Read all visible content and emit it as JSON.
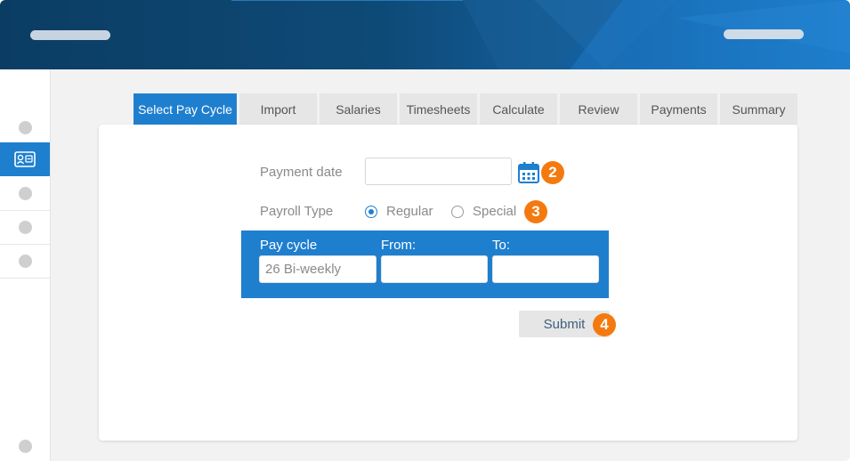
{
  "tabs": [
    {
      "label": "Select Pay Cycle"
    },
    {
      "label": "Import"
    },
    {
      "label": "Salaries"
    },
    {
      "label": "Timesheets"
    },
    {
      "label": "Calculate"
    },
    {
      "label": "Review"
    },
    {
      "label": "Payments"
    },
    {
      "label": "Summary"
    }
  ],
  "form": {
    "payment_date_label": "Payment date",
    "payment_date_value": "",
    "payroll_type_label": "Payroll Type",
    "payroll_options": [
      {
        "label": "Regular",
        "checked": true
      },
      {
        "label": "Special",
        "checked": false
      }
    ],
    "pay_cycle_label": "Pay cycle",
    "pay_cycle_value": "26 Bi-weekly",
    "from_label": "From:",
    "from_value": "",
    "to_label": "To:",
    "to_value": "",
    "submit_label": "Submit"
  },
  "badges": [
    "2",
    "3",
    "4"
  ],
  "colors": {
    "accent": "#1f7fcf",
    "badge": "#f47a10",
    "header_dark": "#0b3d63",
    "header_light": "#1e80d0"
  },
  "icons": {
    "calendar": "calendar-icon",
    "sidebar_active": "id-card-icon"
  }
}
